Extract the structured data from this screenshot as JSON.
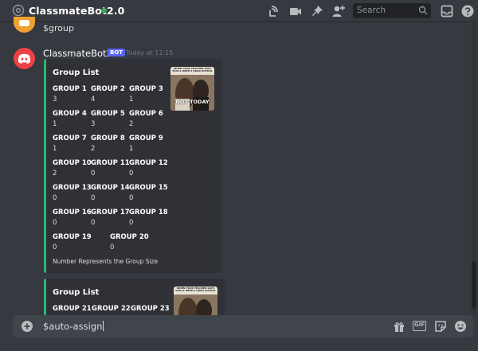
{
  "header": {
    "channel_title": "ClassmateBot2.0",
    "status_color": "#3ba55d",
    "icons": [
      "at-icon",
      "threads-icon",
      "video-call-icon",
      "pin-icon",
      "add-member-icon",
      "inbox-icon",
      "help-icon"
    ],
    "search_placeholder": "Search"
  },
  "previous_message": {
    "text": "$group"
  },
  "message": {
    "author": "ClassmateBot2.0",
    "bot_tag": "BOT",
    "timestamp": "Today at 11:15"
  },
  "embed1": {
    "title": "Group List",
    "thumbnail_caption_top": "WHEN YOUR TEACHER SAYS YOU'LL NEED 2 GRAD SCHOOL",
    "thumbnail_caption_bottom": "NOT TODAY",
    "groups": [
      {
        "label": "GROUP 1",
        "value": "3"
      },
      {
        "label": "GROUP 2",
        "value": "4"
      },
      {
        "label": "GROUP 3",
        "value": "1"
      },
      {
        "label": "GROUP 4",
        "value": "1"
      },
      {
        "label": "GROUP 5",
        "value": "3"
      },
      {
        "label": "GROUP 6",
        "value": "2"
      },
      {
        "label": "GROUP 7",
        "value": "1"
      },
      {
        "label": "GROUP 8",
        "value": "2"
      },
      {
        "label": "GROUP 9",
        "value": "1"
      },
      {
        "label": "GROUP 10",
        "value": "2"
      },
      {
        "label": "GROUP 11",
        "value": "0"
      },
      {
        "label": "GROUP 12",
        "value": "0"
      },
      {
        "label": "GROUP 13",
        "value": "0"
      },
      {
        "label": "GROUP 14",
        "value": "0"
      },
      {
        "label": "GROUP 15",
        "value": "0"
      },
      {
        "label": "GROUP 16",
        "value": "0"
      },
      {
        "label": "GROUP 17",
        "value": "0"
      },
      {
        "label": "GROUP 18",
        "value": "0"
      },
      {
        "label": "GROUP 19",
        "value": "0"
      },
      {
        "label": "GROUP 20",
        "value": "0"
      }
    ],
    "footer": "Number Represents the Group Size",
    "accent_color": "#2bb673"
  },
  "embed2": {
    "title": "Group List",
    "thumbnail_caption_top": "WHEN YOUR TEACHER SAYS YOU'LL NEED 2 GRAD SCHOOL",
    "groups": [
      {
        "label": "GROUP 21"
      },
      {
        "label": "GROUP 22"
      },
      {
        "label": "GROUP 23"
      }
    ]
  },
  "composer": {
    "text": "$auto-assign",
    "icons": [
      "add-attachment-icon",
      "gift-icon",
      "gif-icon",
      "sticker-icon",
      "emoji-icon"
    ],
    "gif_label": "GIF"
  }
}
